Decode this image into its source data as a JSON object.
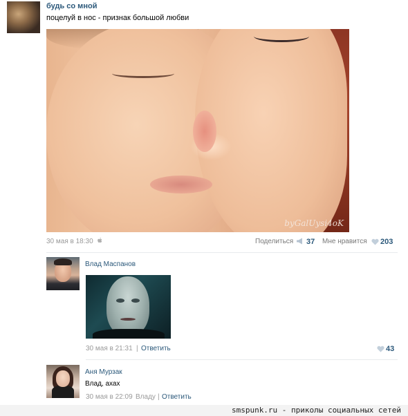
{
  "post": {
    "author": "будь со мной",
    "text": "поцелуй в нос - признак большой любви",
    "photo_watermark": "byGalUysi4oK",
    "date": "30 мая в 18:30",
    "share_label": "Поделиться",
    "share_count": "37",
    "like_label": "Мне нравится",
    "like_count": "203"
  },
  "comments": [
    {
      "author": "Влад Маспанов",
      "date": "30 мая в 21:31",
      "separator": "|",
      "reply_label": "Ответить",
      "likes": "43"
    },
    {
      "author": "Аня Мурзак",
      "text": "Влад, ахах",
      "date": "30 мая в 22:09",
      "reply_to": "Владу",
      "separator": "|",
      "reply_label": "Ответить"
    }
  ],
  "footer": {
    "credit": "smspunk.ru - приколы социальных сетей"
  },
  "icons": {
    "device": "apple-icon",
    "share": "megaphone-icon",
    "like": "heart-icon"
  },
  "colors": {
    "link": "#2b587a",
    "meta": "#999999",
    "divider": "#e7eaed"
  }
}
